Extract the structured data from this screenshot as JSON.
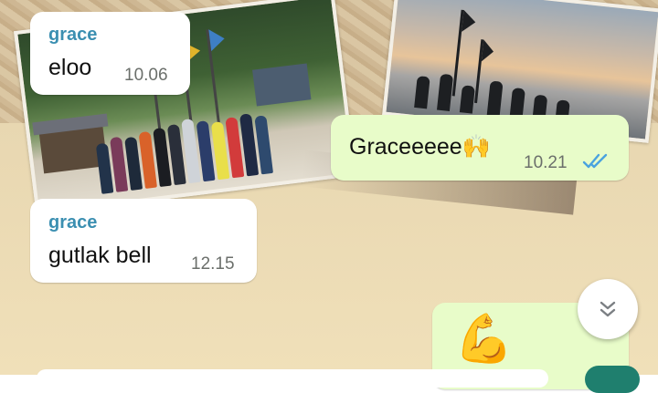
{
  "messages": [
    {
      "sender": "grace",
      "text": "eloo",
      "time": "10.06"
    },
    {
      "text": "Graceeeee🙌",
      "time": "10.21",
      "status": "read"
    },
    {
      "sender": "grace",
      "text": "gutlak bell",
      "time": "12.15"
    },
    {
      "text": "💪"
    }
  ],
  "icons": {
    "scroll_down": "chevrons-down-icon",
    "read_receipt": "double-check-icon"
  },
  "colors": {
    "sender_name": "#3b8fb1",
    "incoming_bubble": "#ffffff",
    "outgoing_bubble": "#e8fcc9",
    "read_check": "#4aa3df"
  }
}
